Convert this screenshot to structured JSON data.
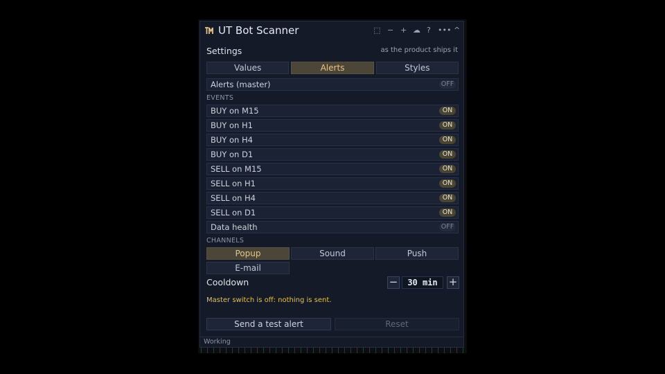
{
  "window": {
    "title": "UT Bot Scanner",
    "controls": [
      "⬚",
      "−",
      "+",
      "☁",
      "?",
      "•••",
      "^"
    ]
  },
  "settings": {
    "heading": "Settings",
    "note": "as the product ships it"
  },
  "tabs": [
    {
      "label": "Values",
      "active": false
    },
    {
      "label": "Alerts",
      "active": true
    },
    {
      "label": "Styles",
      "active": false
    }
  ],
  "master": {
    "label": "Alerts (master)",
    "state": "OFF"
  },
  "events": {
    "heading": "EVENTS",
    "items": [
      {
        "label": "BUY on M15",
        "state": "ON"
      },
      {
        "label": "BUY on H1",
        "state": "ON"
      },
      {
        "label": "BUY on H4",
        "state": "ON"
      },
      {
        "label": "BUY on D1",
        "state": "ON"
      },
      {
        "label": "SELL on M15",
        "state": "ON"
      },
      {
        "label": "SELL on H1",
        "state": "ON"
      },
      {
        "label": "SELL on H4",
        "state": "ON"
      },
      {
        "label": "SELL on D1",
        "state": "ON"
      },
      {
        "label": "Data health",
        "state": "OFF"
      }
    ]
  },
  "channels": {
    "heading": "CHANNELS",
    "items": [
      {
        "label": "Popup",
        "active": true
      },
      {
        "label": "Sound",
        "active": false
      },
      {
        "label": "Push",
        "active": false
      },
      {
        "label": "E-mail",
        "active": false
      }
    ]
  },
  "cooldown": {
    "label": "Cooldown",
    "value": "30 min",
    "minus": "−",
    "plus": "+"
  },
  "warning": "Master switch is off: nothing is sent.",
  "actions": {
    "test": "Send a test alert",
    "reset": "Reset"
  },
  "status": "Working",
  "colors": {
    "accent": "#e6c489",
    "warning": "#e3c14a",
    "panel": "#141a28"
  }
}
